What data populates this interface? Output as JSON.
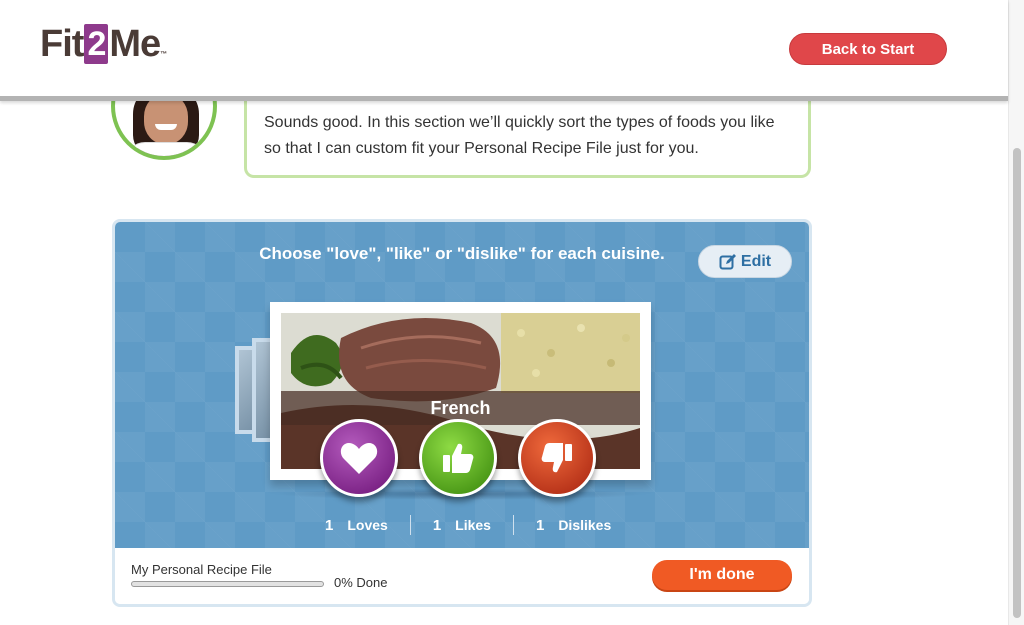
{
  "header": {
    "logo": {
      "part1": "Fit",
      "part2": "2",
      "part3": "Me",
      "tm": "™"
    },
    "back_label": "Back to Start"
  },
  "coach": {
    "message": "Sounds good. In this section we’ll quickly sort the types of foods you like so that I can custom fit your Personal Recipe File just for you."
  },
  "sorter": {
    "instructions": "Choose \"love\", \"like\" or \"dislike\" for each cuisine.",
    "edit_label": "Edit",
    "current_cuisine": "French",
    "counts": {
      "loves": {
        "value": "1",
        "label": "Loves"
      },
      "likes": {
        "value": "1",
        "label": "Likes"
      },
      "dislikes": {
        "value": "1",
        "label": "Dislikes"
      }
    },
    "icons": {
      "love": "heart-icon",
      "like": "thumbs-up-icon",
      "dislike": "thumbs-down-icon",
      "edit": "edit-pencil-icon"
    }
  },
  "recipe_file": {
    "label": "My Personal Recipe File",
    "progress_percent": 0,
    "progress_text": "0% Done",
    "done_label": "I'm done"
  },
  "colors": {
    "brand_purple": "#8e3a8c",
    "back_button": "#e0474a",
    "panel_blue": "#5f9bc6",
    "love": "#7d2487",
    "like": "#4c9a18",
    "dislike": "#b8341a",
    "done_button": "#f05a24",
    "bubble_border": "#c6e4a6"
  }
}
